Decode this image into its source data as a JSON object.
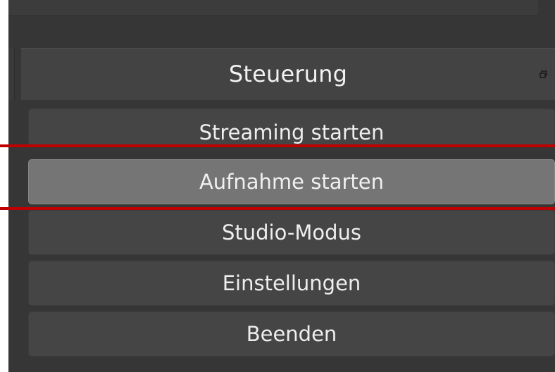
{
  "dock": {
    "title": "Steuerung"
  },
  "controls": {
    "buttons": [
      {
        "label": "Streaming starten"
      },
      {
        "label": "Aufnahme starten"
      },
      {
        "label": "Studio-Modus"
      },
      {
        "label": "Einstellungen"
      },
      {
        "label": "Beenden"
      }
    ]
  },
  "colors": {
    "panel_background": "#363636",
    "header_background": "#434343",
    "button_background": "#454545",
    "button_hover_background": "#757575",
    "highlight_line": "#c00000"
  },
  "icons": {
    "undock": "undock-icon"
  }
}
